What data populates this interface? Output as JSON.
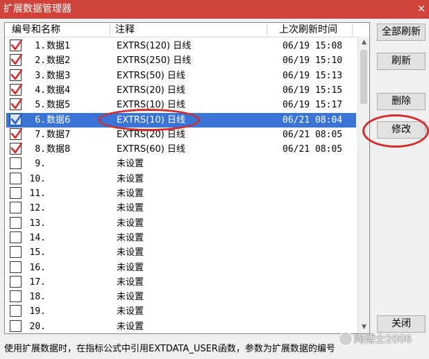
{
  "window": {
    "title": "扩展数据管理器",
    "close_glyph": "×"
  },
  "list": {
    "headers": {
      "name": "编号和名称",
      "note": "注释",
      "time": "上次刷新时间"
    },
    "rows": [
      {
        "no": "1.",
        "name": "数据1",
        "note": "EXTRS(120) 日线",
        "time": "06/19 15:08",
        "checked": true,
        "selected": false
      },
      {
        "no": "2.",
        "name": "数据2",
        "note": "EXTRS(250) 日线",
        "time": "06/19 15:10",
        "checked": true,
        "selected": false
      },
      {
        "no": "3.",
        "name": "数据3",
        "note": "EXTRS(50) 日线",
        "time": "06/19 15:13",
        "checked": true,
        "selected": false
      },
      {
        "no": "4.",
        "name": "数据4",
        "note": "EXTRS(20) 日线",
        "time": "06/19 15:15",
        "checked": true,
        "selected": false
      },
      {
        "no": "5.",
        "name": "数据5",
        "note": "EXTRS(10) 日线",
        "time": "06/19 15:17",
        "checked": true,
        "selected": false
      },
      {
        "no": "6.",
        "name": "数据6",
        "note": "EXTRS(10) 日线",
        "time": "06/21 08:04",
        "checked": true,
        "selected": true
      },
      {
        "no": "7.",
        "name": "数据7",
        "note": "EXTRS(20) 日线",
        "time": "06/21 08:05",
        "checked": true,
        "selected": false
      },
      {
        "no": "8.",
        "name": "数据8",
        "note": "EXTRS(60) 日线",
        "time": "06/21 08:05",
        "checked": true,
        "selected": false
      },
      {
        "no": "9.",
        "name": "",
        "note": "未设置",
        "time": "",
        "checked": false,
        "selected": false
      },
      {
        "no": "10.",
        "name": "",
        "note": "未设置",
        "time": "",
        "checked": false,
        "selected": false
      },
      {
        "no": "11.",
        "name": "",
        "note": "未设置",
        "time": "",
        "checked": false,
        "selected": false
      },
      {
        "no": "12.",
        "name": "",
        "note": "未设置",
        "time": "",
        "checked": false,
        "selected": false
      },
      {
        "no": "13.",
        "name": "",
        "note": "未设置",
        "time": "",
        "checked": false,
        "selected": false
      },
      {
        "no": "14.",
        "name": "",
        "note": "未设置",
        "time": "",
        "checked": false,
        "selected": false
      },
      {
        "no": "15.",
        "name": "",
        "note": "未设置",
        "time": "",
        "checked": false,
        "selected": false
      },
      {
        "no": "16.",
        "name": "",
        "note": "未设置",
        "time": "",
        "checked": false,
        "selected": false
      },
      {
        "no": "17.",
        "name": "",
        "note": "未设置",
        "time": "",
        "checked": false,
        "selected": false
      },
      {
        "no": "18.",
        "name": "",
        "note": "未设置",
        "time": "",
        "checked": false,
        "selected": false
      },
      {
        "no": "19.",
        "name": "",
        "note": "未设置",
        "time": "",
        "checked": false,
        "selected": false
      },
      {
        "no": "20.",
        "name": "",
        "note": "未设置",
        "time": "",
        "checked": false,
        "selected": false
      }
    ]
  },
  "buttons": {
    "refresh_all": "全部刷新",
    "refresh": "刷新",
    "delete": "删除",
    "modify": "修改",
    "close": "关闭"
  },
  "status": {
    "text": "使用扩展数据时，在指标公式中引用EXTDATA_USER函数，参数为扩展数据的编号"
  },
  "watermark": {
    "text": "陶博士2006"
  },
  "colors": {
    "titlebar": "#d0433a",
    "selection": "#3a74d6",
    "checkmark": "#d42b2b",
    "annotation_circle": "#d42b2b"
  },
  "icons": {
    "close": "close-icon",
    "checkbox": "checkbox-icon",
    "scroll_up": "chevron-up-icon",
    "scroll_down": "chevron-down-icon"
  }
}
